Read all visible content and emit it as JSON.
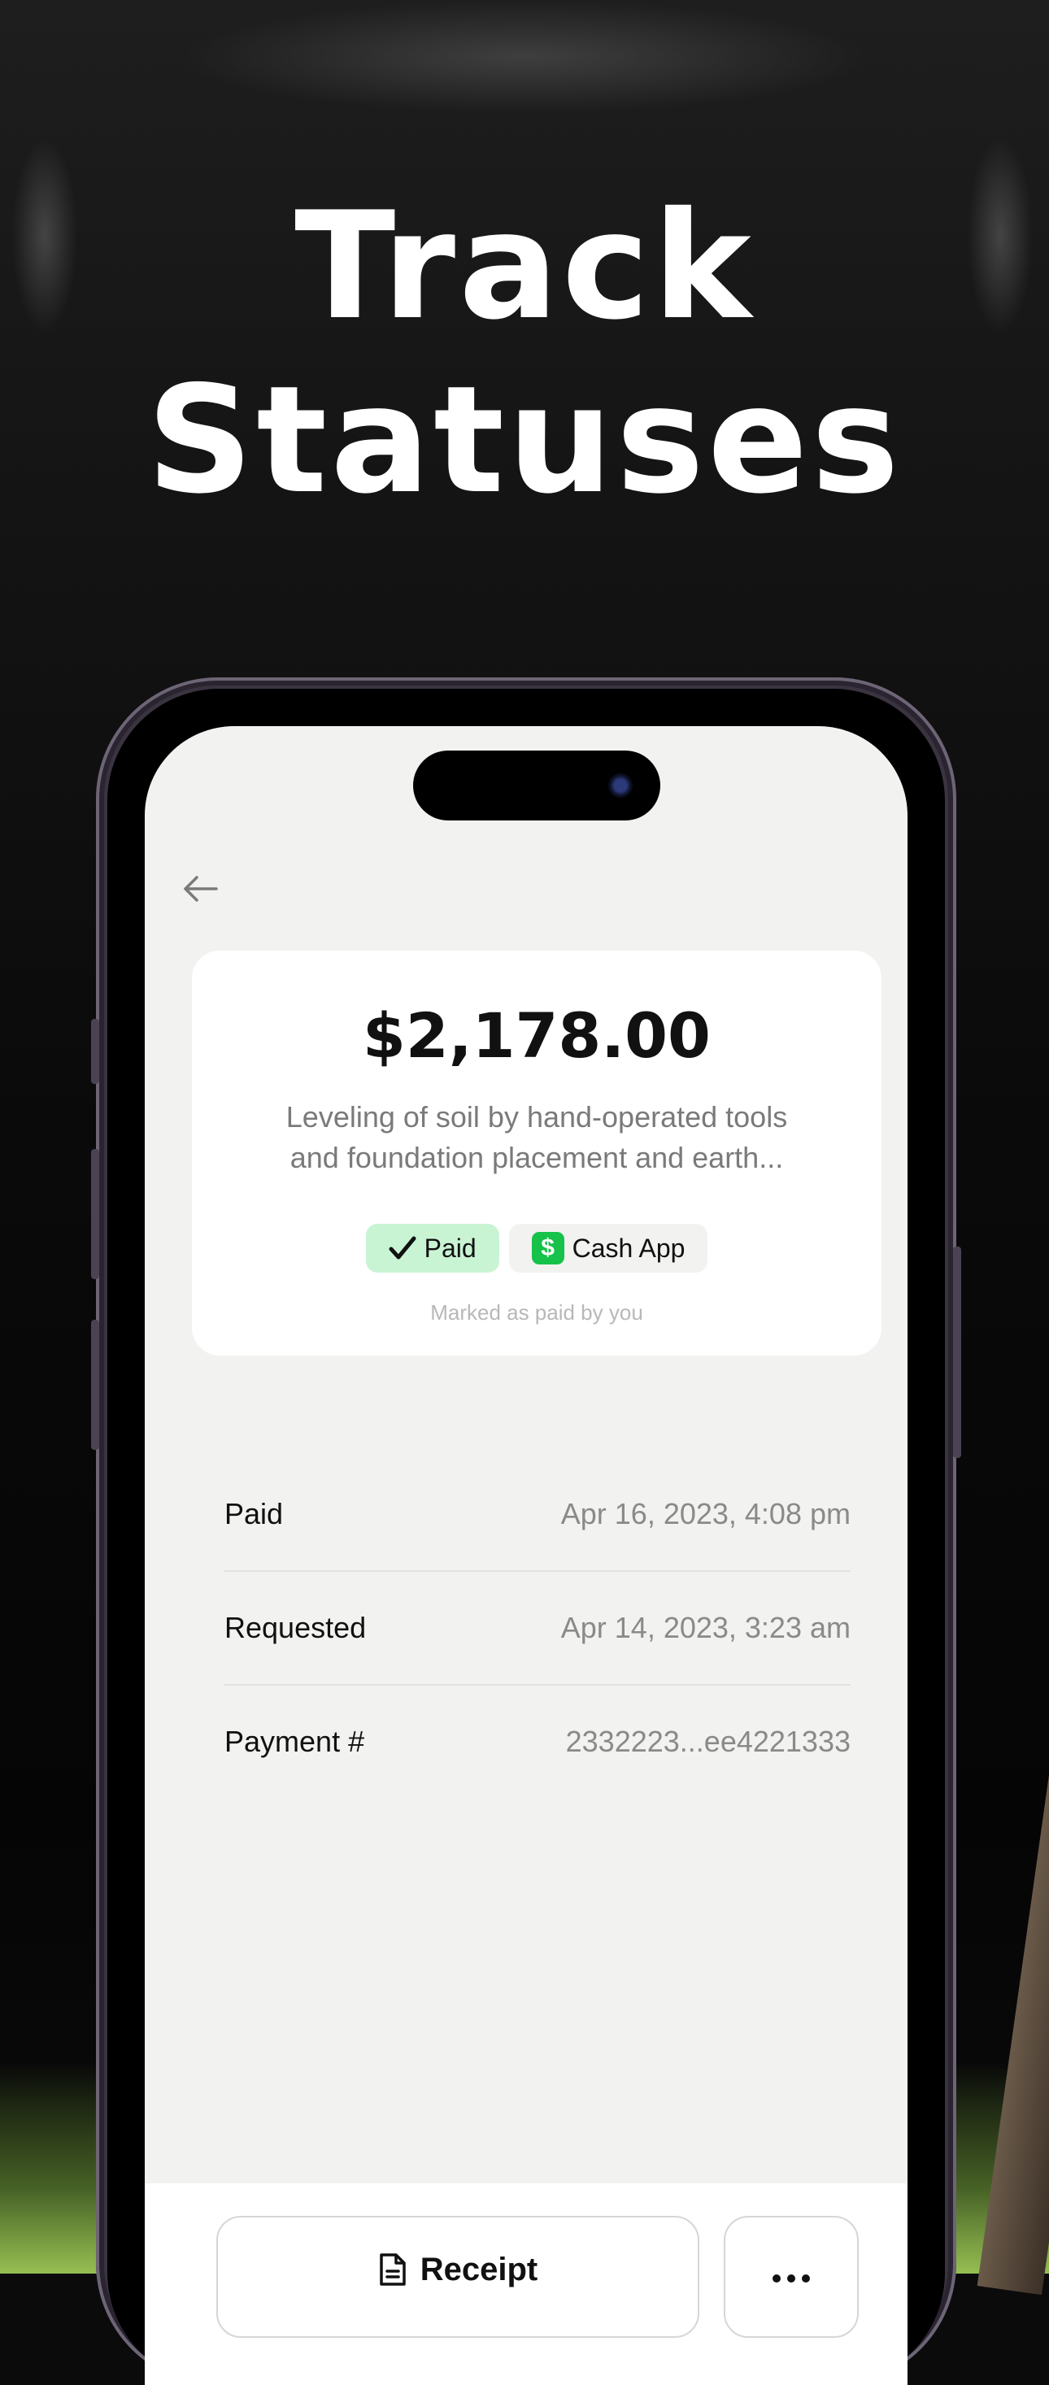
{
  "headline": {
    "line1": "Track",
    "line2": "Statuses"
  },
  "detail": {
    "amount": "$2,178.00",
    "description_line1": "Leveling of soil by hand-operated tools",
    "description_line2": "and foundation placement and earth...",
    "status_badge": "Paid",
    "method_badge": "Cash App",
    "method_icon_glyph": "$",
    "marked_note": "Marked as paid by you"
  },
  "rows": [
    {
      "label": "Paid",
      "value": "Apr 16, 2023, 4:08 pm"
    },
    {
      "label": "Requested",
      "value": "Apr 14, 2023, 3:23 am"
    },
    {
      "label": "Payment #",
      "value": "2332223...ee4221333"
    }
  ],
  "actions": {
    "receipt_label": "Receipt"
  },
  "icons": {
    "back": "arrow-left-icon",
    "check": "checkmark-icon",
    "cash_app": "cash-app-icon",
    "document": "document-icon",
    "more": "ellipsis-icon"
  },
  "colors": {
    "paid_badge_bg": "#c9f4d4",
    "cash_app_green": "#16c24a",
    "screen_bg": "#f2f2f0"
  }
}
